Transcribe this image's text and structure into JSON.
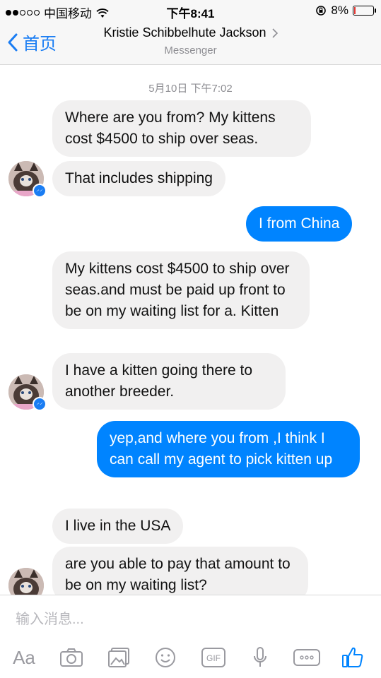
{
  "status_bar": {
    "carrier": "中国移动",
    "time": "下午8:41",
    "battery": "8%"
  },
  "nav": {
    "back_label": "首页",
    "title": "Kristie Schibbelhute Jackson",
    "subtitle": "Messenger"
  },
  "chat": {
    "timestamp": "5月10日 下午7:02",
    "messages": [
      {
        "direction": "in",
        "text": "Where are you from? My kittens cost $4500 to ship over seas."
      },
      {
        "direction": "in",
        "text": "That includes shipping"
      },
      {
        "direction": "out",
        "text": "I from China"
      },
      {
        "direction": "in",
        "text": "My kittens cost $4500 to ship over seas.and must be paid up front to be on my waiting list for a. Kitten"
      },
      {
        "direction": "in",
        "text": "I have a kitten going there to another breeder."
      },
      {
        "direction": "out",
        "text": "yep,and where you from ,I think I can call my agent to pick kitten up"
      },
      {
        "direction": "in",
        "text": "I live in the USA"
      },
      {
        "direction": "in",
        "text": "are you able to pay that amount to be on my waiting list?"
      }
    ]
  },
  "input": {
    "placeholder": "输入消息..."
  },
  "toolbar": {
    "text_label": "Aa",
    "icons": [
      "aa-icon",
      "camera-icon",
      "photo-icon",
      "emoji-icon",
      "gif-icon",
      "microphone-icon",
      "more-icon",
      "like-icon"
    ]
  },
  "colors": {
    "accent": "#0084ff",
    "incoming_bubble": "#f1f0f0",
    "nav_link": "#1a7df3",
    "battery_low": "#e53935"
  }
}
